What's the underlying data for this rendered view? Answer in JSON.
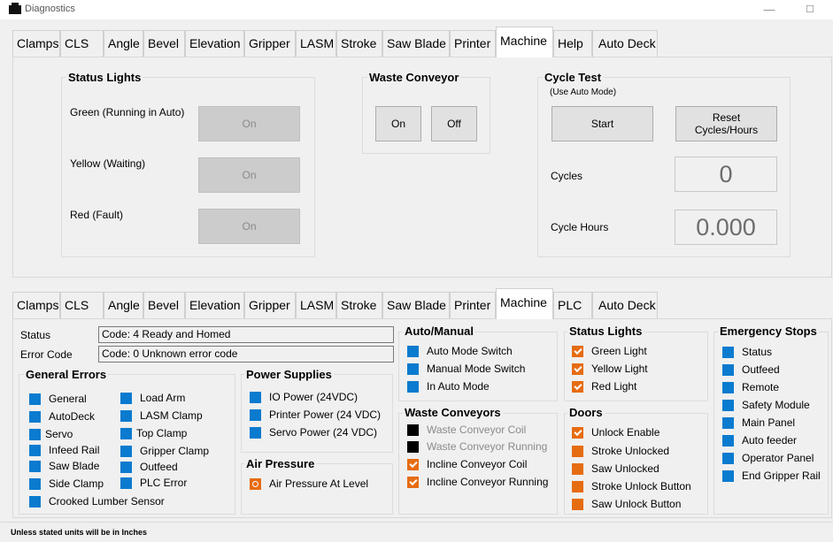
{
  "window": {
    "title": "Diagnostics",
    "minimize": "—",
    "maximize": "☐",
    "close": "✕"
  },
  "top_tabs": [
    {
      "label": "Clamps"
    },
    {
      "label": "CLS"
    },
    {
      "label": "Angle"
    },
    {
      "label": "Bevel"
    },
    {
      "label": "Elevation"
    },
    {
      "label": "Gripper"
    },
    {
      "label": "LASM"
    },
    {
      "label": "Stroke"
    },
    {
      "label": "Saw Blade"
    },
    {
      "label": "Printer"
    },
    {
      "label": "Machine",
      "active": true
    },
    {
      "label": "Help"
    },
    {
      "label": "Auto Deck"
    }
  ],
  "status_lights": {
    "title": "Status Lights",
    "green_label": "Green (Running in Auto)",
    "green_button": "On",
    "yellow_label": "Yellow (Waiting)",
    "yellow_button": "On",
    "red_label": "Red (Fault)",
    "red_button": "On"
  },
  "waste_conveyor": {
    "title": "Waste Conveyor",
    "on_label": "On",
    "off_label": "Off"
  },
  "cycle_test": {
    "title": "Cycle Test",
    "subtitle": "(Use Auto Mode)",
    "start_label": "Start",
    "reset_label_1": "Reset",
    "reset_label_2": "Cycles/Hours",
    "cycles_label": "Cycles",
    "cycles_value": "0",
    "hours_label": "Cycle Hours",
    "hours_value": "0.000"
  },
  "bottom_tabs": [
    {
      "label": "Clamps"
    },
    {
      "label": "CLS"
    },
    {
      "label": "Angle"
    },
    {
      "label": "Bevel"
    },
    {
      "label": "Elevation"
    },
    {
      "label": "Gripper"
    },
    {
      "label": "LASM"
    },
    {
      "label": "Stroke"
    },
    {
      "label": "Saw Blade"
    },
    {
      "label": "Printer"
    },
    {
      "label": "Machine",
      "active": true
    },
    {
      "label": "PLC"
    },
    {
      "label": "Auto Deck"
    }
  ],
  "status_area": {
    "status_label": "Status",
    "status_value": "Code: 4 Ready and Homed",
    "error_label": "Error Code",
    "error_value": "Code: 0 Unknown error code"
  },
  "general_errors": {
    "title": "General Errors",
    "col1": [
      "General",
      "AutoDeck",
      "Servo",
      "Infeed Rail",
      "Saw Blade",
      "Side Clamp",
      "Crooked Lumber Sensor"
    ],
    "col2": [
      "Load Arm",
      "LASM Clamp",
      "Top Clamp",
      "Gripper Clamp",
      "Outfeed",
      "PLC Error"
    ]
  },
  "power_supplies": {
    "title": "Power Supplies",
    "items": [
      "IO Power (24VDC)",
      "Printer Power (24 VDC)",
      "Servo Power (24 VDC)"
    ]
  },
  "air_pressure": {
    "title": "Air Pressure",
    "item": "Air Pressure At Level"
  },
  "auto_manual": {
    "title": "Auto/Manual",
    "items": [
      "Auto Mode Switch",
      "Manual Mode Switch",
      "In Auto Mode"
    ]
  },
  "waste_conveyors": {
    "title": "Waste Conveyors",
    "items": [
      "Waste Conveyor Coil",
      "Waste Conveyor Running",
      "Incline Conveyor Coil",
      "Incline Conveyor Running"
    ]
  },
  "status_lights_io": {
    "title": "Status Lights",
    "items": [
      "Green Light",
      "Yellow Light",
      "Red Light"
    ]
  },
  "doors": {
    "title": "Doors",
    "items": [
      "Unlock Enable",
      "Stroke Unlocked",
      "Saw Unlocked",
      "Stroke Unlock Button",
      "Saw Unlock Button"
    ]
  },
  "emergency_stops": {
    "title": "Emergency Stops",
    "items": [
      "Status",
      "Outfeed",
      "Remote",
      "Safety Module",
      "Main Panel",
      "Auto feeder",
      "Operator Panel",
      "End Gripper Rail"
    ]
  },
  "colors": {
    "on_blue": "#0a7bcf",
    "active_orange": "#e66c12",
    "off_black": "#000000"
  },
  "status_bar": "Unless stated units will be in Inches"
}
